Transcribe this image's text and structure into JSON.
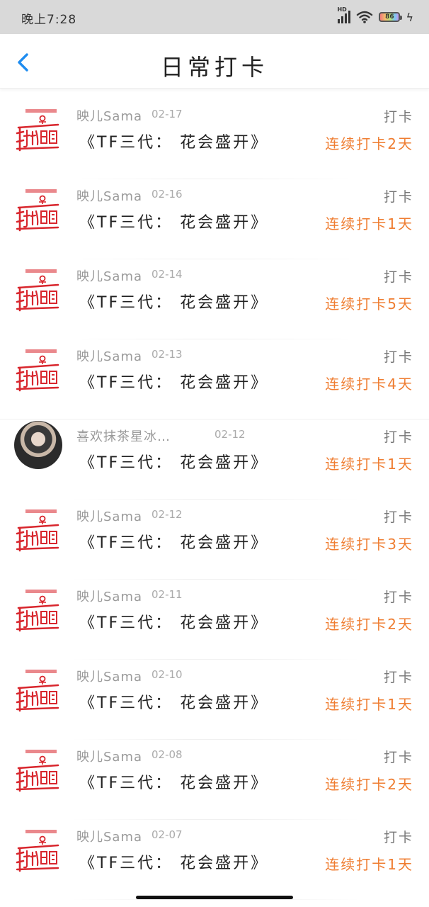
{
  "status_bar": {
    "time": "晚上7:28",
    "hd": "HD",
    "battery_level": "86",
    "charging_icon": "lightning-icon"
  },
  "header": {
    "back_icon": "chevron-left-icon",
    "title": "日常打卡"
  },
  "colors": {
    "accent": "#ef7d31",
    "back_icon": "#1e8cf0",
    "logo_red": "#d8262d"
  },
  "entries": [
    {
      "avatar": "shouji-mianting-logo",
      "user": "映儿Sama",
      "date": "02-17",
      "title": "《TF三代： 花会盛开》",
      "label": "打卡",
      "streak": "连续打卡2天"
    },
    {
      "avatar": "shouji-mianting-logo",
      "user": "映儿Sama",
      "date": "02-16",
      "title": "《TF三代： 花会盛开》",
      "label": "打卡",
      "streak": "连续打卡1天"
    },
    {
      "avatar": "shouji-mianting-logo",
      "user": "映儿Sama",
      "date": "02-14",
      "title": "《TF三代： 花会盛开》",
      "label": "打卡",
      "streak": "连续打卡5天"
    },
    {
      "avatar": "shouji-mianting-logo",
      "user": "映儿Sama",
      "date": "02-13",
      "title": "《TF三代： 花会盛开》",
      "label": "打卡",
      "streak": "连续打卡4天"
    },
    {
      "avatar": "user-photo",
      "user": "喜欢抹茶星冰…",
      "date": "02-12",
      "title": "《TF三代： 花会盛开》",
      "label": "打卡",
      "streak": "连续打卡1天"
    },
    {
      "avatar": "shouji-mianting-logo",
      "user": "映儿Sama",
      "date": "02-12",
      "title": "《TF三代： 花会盛开》",
      "label": "打卡",
      "streak": "连续打卡3天"
    },
    {
      "avatar": "shouji-mianting-logo",
      "user": "映儿Sama",
      "date": "02-11",
      "title": "《TF三代： 花会盛开》",
      "label": "打卡",
      "streak": "连续打卡2天"
    },
    {
      "avatar": "shouji-mianting-logo",
      "user": "映儿Sama",
      "date": "02-10",
      "title": "《TF三代： 花会盛开》",
      "label": "打卡",
      "streak": "连续打卡1天"
    },
    {
      "avatar": "shouji-mianting-logo",
      "user": "映儿Sama",
      "date": "02-08",
      "title": "《TF三代： 花会盛开》",
      "label": "打卡",
      "streak": "连续打卡2天"
    },
    {
      "avatar": "shouji-mianting-logo",
      "user": "映儿Sama",
      "date": "02-07",
      "title": "《TF三代： 花会盛开》",
      "label": "打卡",
      "streak": "连续打卡1天"
    }
  ]
}
